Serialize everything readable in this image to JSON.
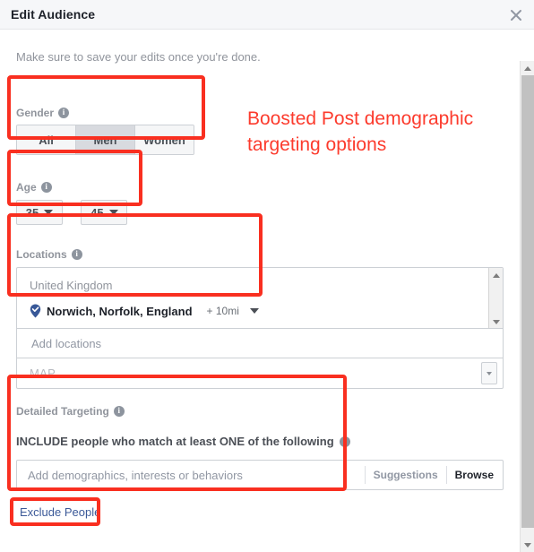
{
  "dialog": {
    "title": "Edit Audience",
    "close_icon": "close-icon",
    "hint": "Make sure to save your edits once you're done."
  },
  "gender": {
    "label": "Gender",
    "options": [
      {
        "label": "All",
        "selected": false
      },
      {
        "label": "Men",
        "selected": true
      },
      {
        "label": "Women",
        "selected": false
      }
    ]
  },
  "age": {
    "label": "Age",
    "min": "35",
    "max": "45",
    "separator": "-"
  },
  "locations": {
    "label": "Locations",
    "country": "United Kingdom",
    "entry": {
      "name": "Norwich, Norfolk, England",
      "radius": "+ 10mi",
      "pin_icon": "location-pin-icon"
    },
    "add_placeholder": "Add locations",
    "add_value": "",
    "map_label": "MAP"
  },
  "detailed_targeting": {
    "label": "Detailed Targeting",
    "include_text": "INCLUDE people who match at least ONE of the following",
    "input_placeholder": "Add demographics, interests or behaviors",
    "input_value": "",
    "suggestions_label": "Suggestions",
    "browse_label": "Browse"
  },
  "exclude": {
    "label": "Exclude People"
  },
  "annotation": {
    "text": "Boosted Post demographic targeting options",
    "color": "#fc3b2d"
  },
  "colors": {
    "annotation_red": "#f92f20",
    "link_blue": "#3b5998",
    "selected_gray": "#d8dadf",
    "pin_blue": "#385898"
  }
}
